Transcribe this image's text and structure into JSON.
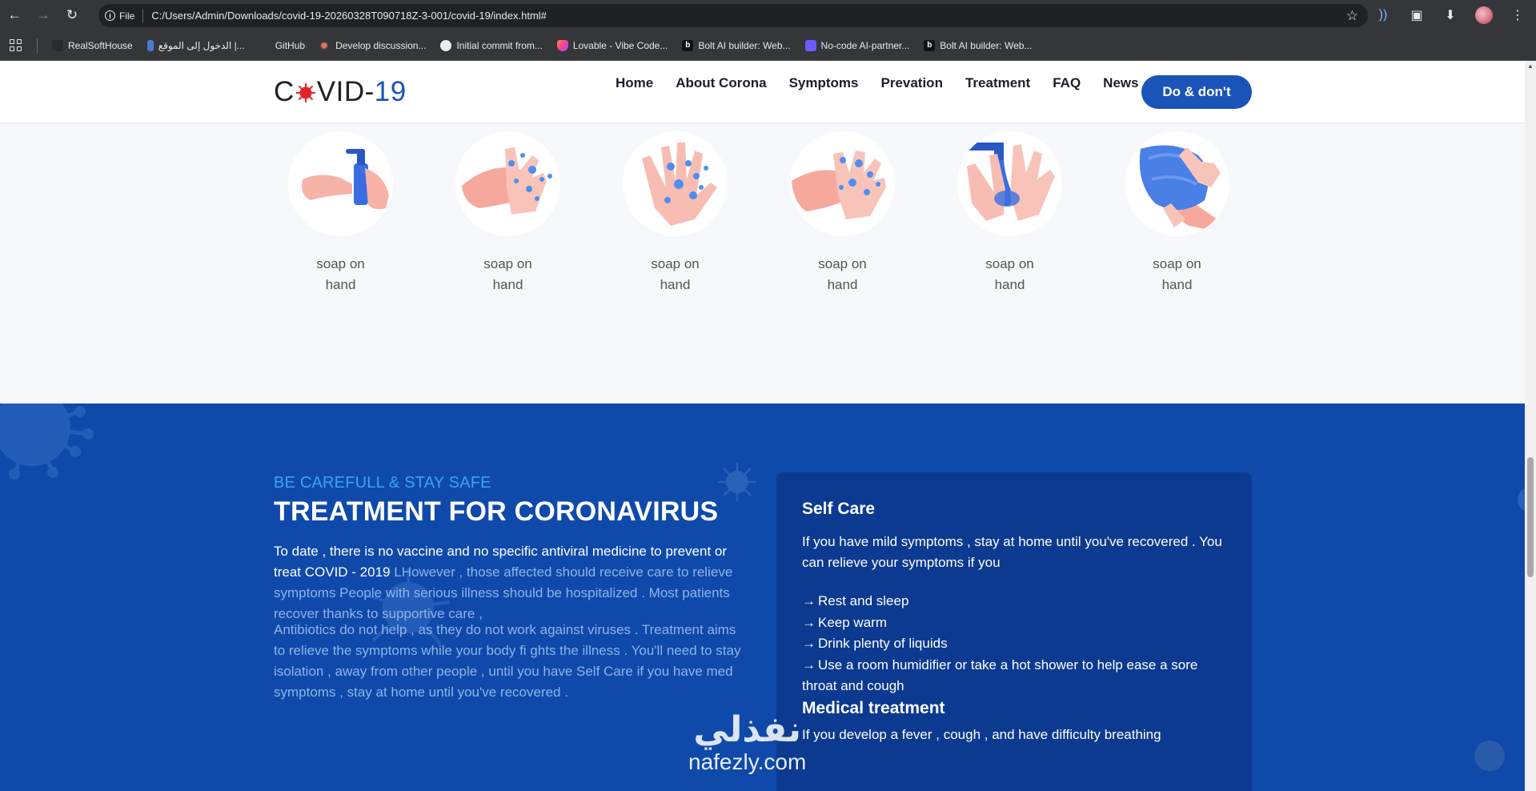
{
  "browser": {
    "url": "C:/Users/Admin/Downloads/covid-19-20260328T090718Z-3-001/covid-19/index.html#",
    "scheme_chip": "File",
    "nav_icons": [
      "back-icon",
      "forward-icon",
      "reload-icon"
    ],
    "bookmarks": [
      {
        "label": "RealSoftHouse",
        "icon": "rsh-icon",
        "color": "#2b2b2b"
      },
      {
        "label": "الدخول إلى الموقع |...",
        "icon": "bookmark-icon",
        "color": "#4a7bd1"
      },
      {
        "label": "GitHub",
        "icon": "github-blank-icon",
        "color": "#35363a"
      },
      {
        "label": "Develop discussion...",
        "icon": "claude-icon",
        "color": "#d97757"
      },
      {
        "label": "Initial commit from...",
        "icon": "github-icon",
        "color": "#e8eaed"
      },
      {
        "label": "Lovable - Vibe Code...",
        "icon": "lovable-icon",
        "color": "#ff5e8a"
      },
      {
        "label": "Bolt AI builder: Web...",
        "icon": "bolt-icon",
        "color": "#111111"
      },
      {
        "label": "No-code AI-partner...",
        "icon": "partner-icon",
        "color": "#6b5cff"
      },
      {
        "label": "Bolt AI builder: Web...",
        "icon": "bolt-icon",
        "color": "#111111"
      }
    ]
  },
  "site": {
    "logo": {
      "prefix": "C",
      "middle": "VID-",
      "number": "19"
    },
    "nav": [
      "Home",
      "About Corona",
      "Symptoms",
      "Prevation",
      "Treatment",
      "FAQ",
      "News"
    ],
    "cta": "Do & don't",
    "brand_color": "#1a54b8"
  },
  "steps": [
    {
      "label": "soap on hand",
      "icon": "hand-sanitizer-icon"
    },
    {
      "label": "soap on hand",
      "icon": "lathering-hands-icon"
    },
    {
      "label": "soap on hand",
      "icon": "soapy-hands-icon"
    },
    {
      "label": "soap on hand",
      "icon": "scrubbing-hands-icon"
    },
    {
      "label": "soap on hand",
      "icon": "rinsing-hands-icon"
    },
    {
      "label": "soap on hand",
      "icon": "drying-hands-icon"
    }
  ],
  "treatment": {
    "eyebrow": "BE CAREFULL & STAY SAFE",
    "title": "TREATMENT FOR CORONAVIRUS",
    "para1_a": "To date , there is no vaccine and no specific antiviral medicine to prevent or treat COVID - 2019 ",
    "para1_b": "LHowever , those affected should receive care to relieve symptoms People with serious illness should be hospitalized . Most patients recover thanks to supportive care ,",
    "para2": "Antibiotics do not help , as they do not work against viruses . Treatment aims to relieve the symptoms while your body fi ghts the illness . You'll need to stay isolation , away from other people , until you have Self Care if you have med symptoms , stay at home until you've recovered .",
    "section_color": "#0f4aaa",
    "card": {
      "title": "Self Care",
      "intro": "If you have mild symptoms , stay at home until you've recovered . You can relieve your symptoms if you",
      "items": [
        "Rest and sleep",
        "Keep warm",
        "Drink plenty of liquids",
        "Use a room humidifier or take a hot shower to help ease a sore throat and cough"
      ],
      "med_title": "Medical treatment",
      "med_text": "If you develop a fever , cough , and have difficulty breathing"
    }
  },
  "watermark": {
    "arabic": "نفذلي",
    "latin": "nafezly.com"
  }
}
